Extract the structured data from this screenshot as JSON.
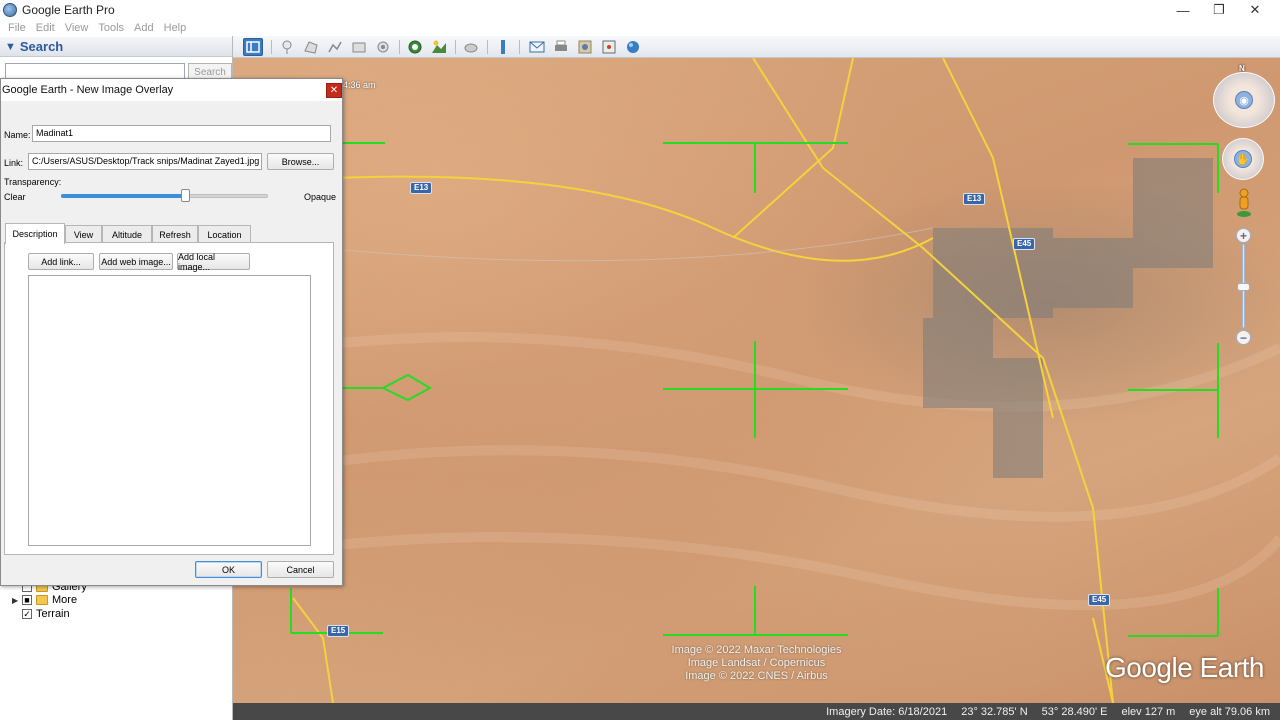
{
  "window": {
    "title": "Google Earth Pro",
    "minimize_icon": "minimize-icon",
    "maximize_icon": "restore-icon",
    "close_icon": "close-icon"
  },
  "menu": [
    "File",
    "Edit",
    "View",
    "Tools",
    "Add",
    "Help"
  ],
  "search_panel": {
    "title": "Search",
    "input_value": "",
    "button_label": "Search"
  },
  "layers": [
    {
      "label": "Gallery",
      "checked": false
    },
    {
      "label": "More",
      "checked": false
    },
    {
      "label": "Terrain",
      "checked": true
    }
  ],
  "toolbar_icons": [
    "sidebar-toggle-icon",
    "placemark-icon",
    "polygon-icon",
    "path-icon",
    "image-overlay-icon",
    "record-tour-icon",
    "historical-imagery-icon",
    "sunlight-icon",
    "planets-icon",
    "ruler-icon",
    "email-icon",
    "print-icon",
    "save-image-icon",
    "view-in-maps-icon",
    "earth-icon"
  ],
  "dialog": {
    "title": "Google Earth - New Image Overlay",
    "name_label": "Name:",
    "name_value": "Madinat1",
    "link_label": "Link:",
    "link_value": "C:/Users/ASUS/Desktop/Track snips/Madinat Zayed1.jpg",
    "browse_label": "Browse...",
    "transparency_label": "Transparency:",
    "clear_label": "Clear",
    "opaque_label": "Opaque",
    "transparency_value": 0.6,
    "tabs": [
      "Description",
      "View",
      "Altitude",
      "Refresh",
      "Location"
    ],
    "active_tab": "Description",
    "add_link_label": "Add link...",
    "add_web_image_label": "Add web image...",
    "add_local_image_label": "Add local image...",
    "description_value": "",
    "ok_label": "OK",
    "cancel_label": "Cancel"
  },
  "map": {
    "road_labels": [
      "E13",
      "E13",
      "E45",
      "E15",
      "E45"
    ],
    "time_label": "4:36 am",
    "attribution": [
      "Image © 2022 Maxar Technologies",
      "Image Landsat / Copernicus",
      "Image © 2022 CNES / Airbus"
    ],
    "logo": "Google Earth",
    "north_label": "N",
    "overlay_color": "#22dd22",
    "road_color": "#f4d23c"
  },
  "status_bar": {
    "imagery_date": "Imagery Date: 6/18/2021",
    "lat": "23° 32.785' N",
    "lon": "53° 28.490' E",
    "elev": "elev  127 m",
    "eye_alt": "eye alt  79.06 km"
  }
}
